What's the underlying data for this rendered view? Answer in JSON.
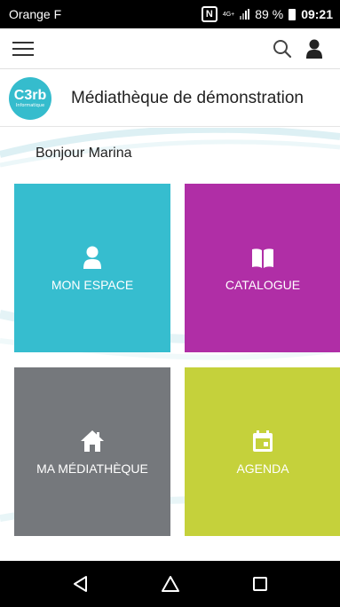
{
  "status_bar": {
    "carrier": "Orange F",
    "nfc": "N",
    "network": "4G+",
    "battery": "89 %",
    "time": "09:21"
  },
  "app_bar": {
    "menu_icon": "hamburger-icon",
    "search_icon": "search-icon",
    "account_icon": "user-icon"
  },
  "library": {
    "logo_text": "C3rb",
    "logo_subtext": "Informatique",
    "name": "Médiathèque de démonstration"
  },
  "greeting": "Bonjour Marina",
  "tiles": [
    {
      "label": "MON ESPACE",
      "icon": "user-icon",
      "color": "#36bdcf"
    },
    {
      "label": "CATALOGUE",
      "icon": "book-icon",
      "color": "#b02ea6"
    },
    {
      "label": "MA MÉDIATHÈQUE",
      "icon": "home-icon",
      "color": "#75787c"
    },
    {
      "label": "AGENDA",
      "icon": "calendar-icon",
      "color": "#c5d13b"
    }
  ],
  "nav_bar": {
    "back_icon": "back-icon",
    "home_icon": "home-icon",
    "recents_icon": "recents-icon"
  }
}
